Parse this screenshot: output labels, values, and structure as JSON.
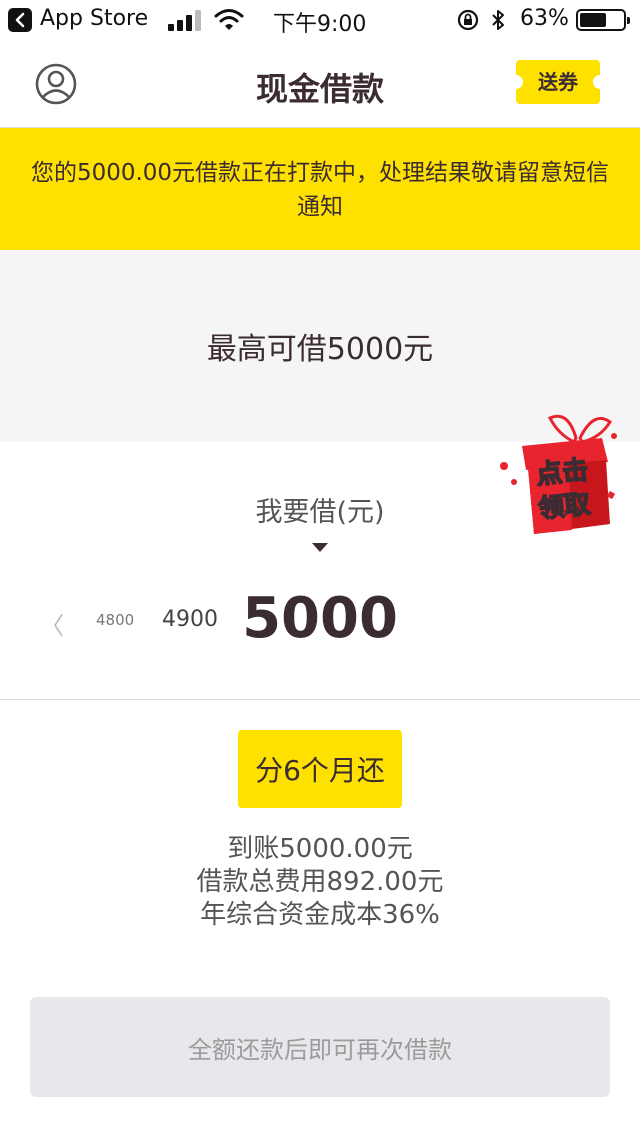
{
  "status_bar": {
    "back_app": "App Store",
    "time": "下午9:00",
    "battery_percent": "63%",
    "battery_level": 0.63
  },
  "nav": {
    "title": "现金借款",
    "coupon_label": "送券",
    "user_icon": "user-circle-icon"
  },
  "notice": {
    "text": "您的5000.00元借款正在打款中，处理结果敬请留意短信通知"
  },
  "limit": {
    "text": "最高可借5000元"
  },
  "gift": {
    "line1": "点击",
    "line2": "领取"
  },
  "amount": {
    "label": "我要借(元)",
    "prev_arrow": "〈",
    "options": [
      "4800",
      "4900",
      "5000"
    ],
    "selected": "5000"
  },
  "term": {
    "label": "分6个月还"
  },
  "info": {
    "line1": "到账5000.00元",
    "line2": "借款总费用892.00元",
    "line3": "年综合资金成本36%"
  },
  "submit": {
    "label": "全额还款后即可再次借款"
  },
  "colors": {
    "accent": "#ffe100",
    "text_dark": "#3a2c32",
    "gift_red": "#e8242e"
  }
}
